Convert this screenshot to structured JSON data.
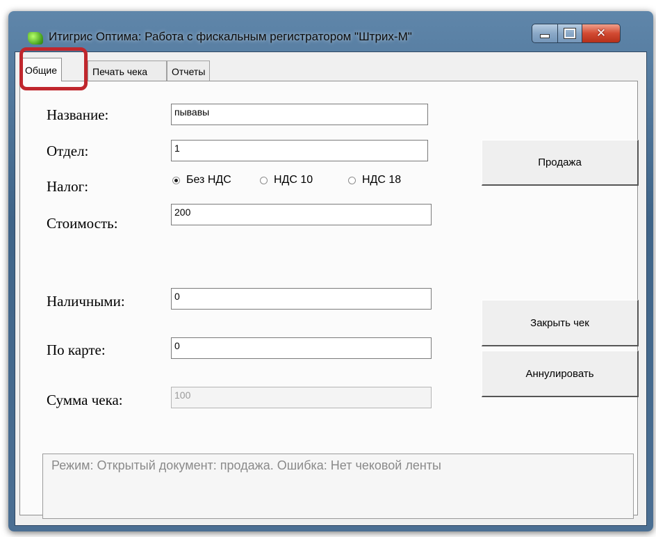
{
  "window": {
    "title": "Итигрис Оптима: Работа с фискальным регистратором \"Штрих-М\"",
    "close_glyph": "✕"
  },
  "tabs": [
    {
      "label": "Общие",
      "active": true
    },
    {
      "label": "Печать чека",
      "active": false
    },
    {
      "label": "Отчеты",
      "active": false
    }
  ],
  "form": {
    "name_label": "Название:",
    "name_value": "пывавы",
    "dept_label": "Отдел:",
    "dept_value": "1",
    "tax_label": "Налог:",
    "tax_options": [
      {
        "label": "Без НДС",
        "checked": true
      },
      {
        "label": "НДС 10",
        "checked": false
      },
      {
        "label": "НДС 18",
        "checked": false
      }
    ],
    "cost_label": "Стоимость:",
    "cost_value": "200",
    "cash_label": "Наличными:",
    "cash_value": "0",
    "card_label": "По карте:",
    "card_value": "0",
    "total_label": "Сумма чека:",
    "total_value": "100"
  },
  "buttons": {
    "sale": "Продажа",
    "close_check": "Закрыть чек",
    "cancel": "Аннулировать"
  },
  "status": {
    "text": "Режим: Открытый документ: продажа. Ошибка: Нет чековой ленты"
  },
  "icons": {
    "app": "app-icon",
    "minimize": "minimize-icon",
    "maximize": "maximize-icon",
    "close": "close-icon"
  },
  "colors": {
    "highlight": "#c0272d",
    "close_button": "#d24a32",
    "title_bar": "#4b6f93"
  }
}
